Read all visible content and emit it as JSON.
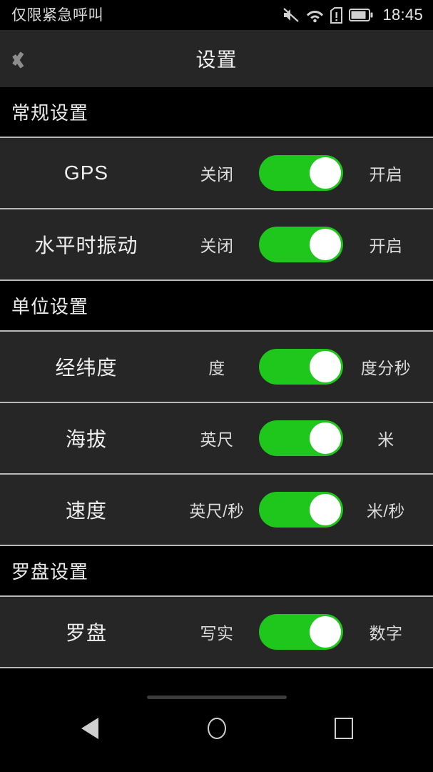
{
  "status_bar": {
    "carrier": "仅限紧急呼叫",
    "time": "18:45",
    "icons": [
      "mute-icon",
      "wifi-icon",
      "sim-card-alert-icon",
      "battery-icon"
    ]
  },
  "header": {
    "title": "设置",
    "back_icon": "chevron-left-icon"
  },
  "sections": [
    {
      "title": "常规设置",
      "rows": [
        {
          "label": "GPS",
          "left_option": "关闭",
          "right_option": "开启",
          "state": "right"
        },
        {
          "label": "水平时振动",
          "left_option": "关闭",
          "right_option": "开启",
          "state": "right"
        }
      ]
    },
    {
      "title": "单位设置",
      "rows": [
        {
          "label": "经纬度",
          "left_option": "度",
          "right_option": "度分秒",
          "state": "right"
        },
        {
          "label": "海拔",
          "left_option": "英尺",
          "right_option": "米",
          "state": "right"
        },
        {
          "label": "速度",
          "left_option": "英尺/秒",
          "right_option": "米/秒",
          "state": "right"
        }
      ]
    },
    {
      "title": "罗盘设置",
      "rows": [
        {
          "label": "罗盘",
          "left_option": "写实",
          "right_option": "数字",
          "state": "right"
        }
      ]
    }
  ],
  "nav_bar": {
    "back_icon": "triangle-back-icon",
    "home_icon": "circle-home-icon",
    "recents_icon": "square-recents-icon"
  },
  "colors": {
    "accent_green": "#1fc61c",
    "row_background": "#262626",
    "page_background": "#000000",
    "separator": "#b9b9b9"
  }
}
